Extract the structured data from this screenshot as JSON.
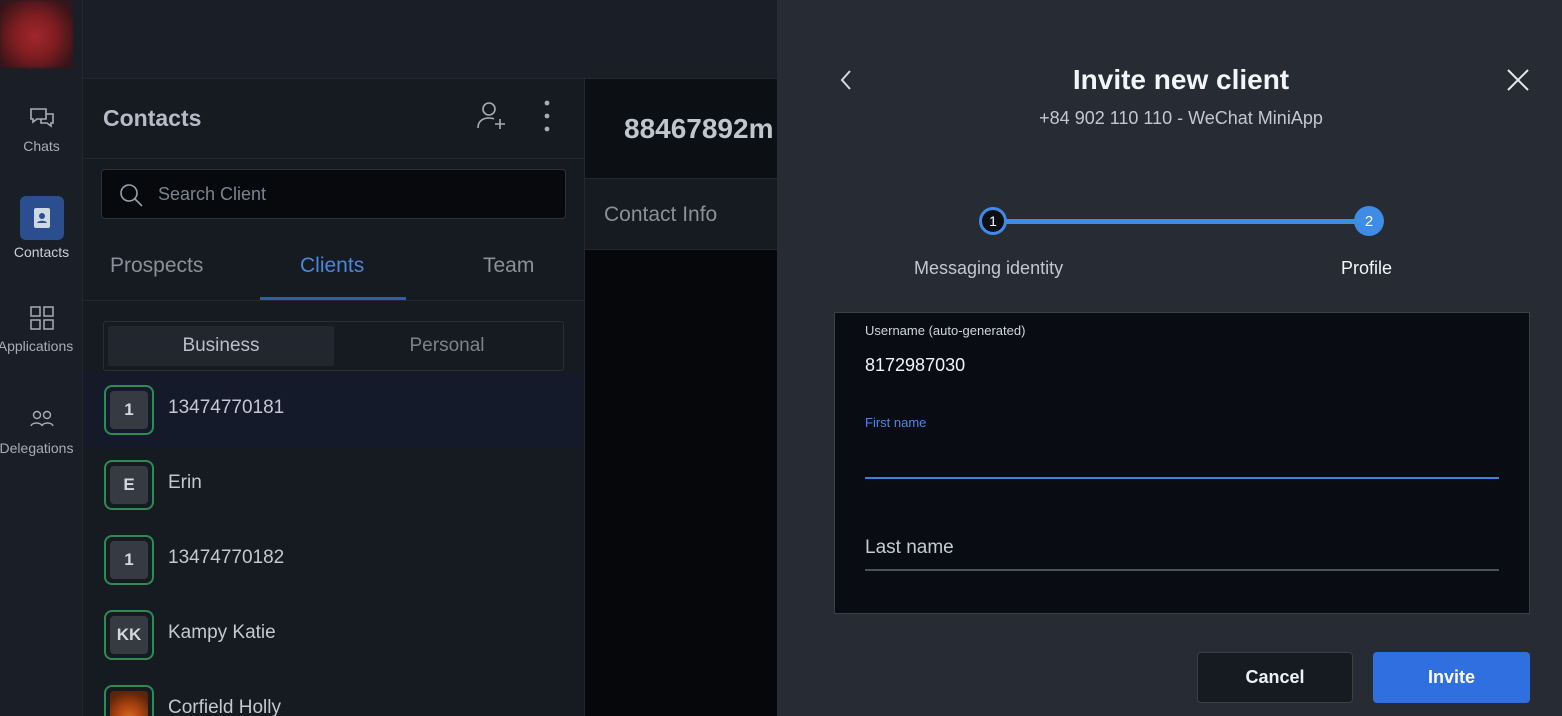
{
  "rail": {
    "items": [
      {
        "label": "Chats",
        "icon": "chat-bubbles-icon"
      },
      {
        "label": "Contacts",
        "icon": "contact-book-icon",
        "active": true
      },
      {
        "label": "Applications",
        "icon": "grid-icon"
      },
      {
        "label": "Delegations",
        "icon": "people-arrows-icon"
      }
    ]
  },
  "contacts": {
    "title": "Contacts",
    "search_placeholder": "Search Client",
    "tabs": [
      "Prospects",
      "Clients",
      "Team"
    ],
    "active_tab": "Clients",
    "segments": [
      "Business",
      "Personal"
    ],
    "active_segment": "Business",
    "list": [
      {
        "avatar": "1",
        "name": "13474770181",
        "selected": true
      },
      {
        "avatar": "E",
        "name": "Erin"
      },
      {
        "avatar": "1",
        "name": "13474770182"
      },
      {
        "avatar": "KK",
        "name": "Kampy Katie"
      },
      {
        "avatar": "",
        "name": "Corfield Holly",
        "photo": true
      }
    ]
  },
  "chat": {
    "title": "88467892m",
    "tab": "Contact Info"
  },
  "modal": {
    "title": "Invite new client",
    "subtitle": "+84 902 110 110 - WeChat MiniApp",
    "steps": [
      {
        "number": "1",
        "label": "Messaging identity"
      },
      {
        "number": "2",
        "label": "Profile"
      }
    ],
    "username_label": "Username (auto-generated)",
    "username_value": "8172987030",
    "first_name_label": "First name",
    "first_name_value": "",
    "last_name_placeholder": "Last name",
    "cancel_label": "Cancel",
    "invite_label": "Invite"
  },
  "colors": {
    "accent": "#3e8ce6",
    "invite_button": "#2f6fe0",
    "avatar_ring": "#2f8a56"
  }
}
